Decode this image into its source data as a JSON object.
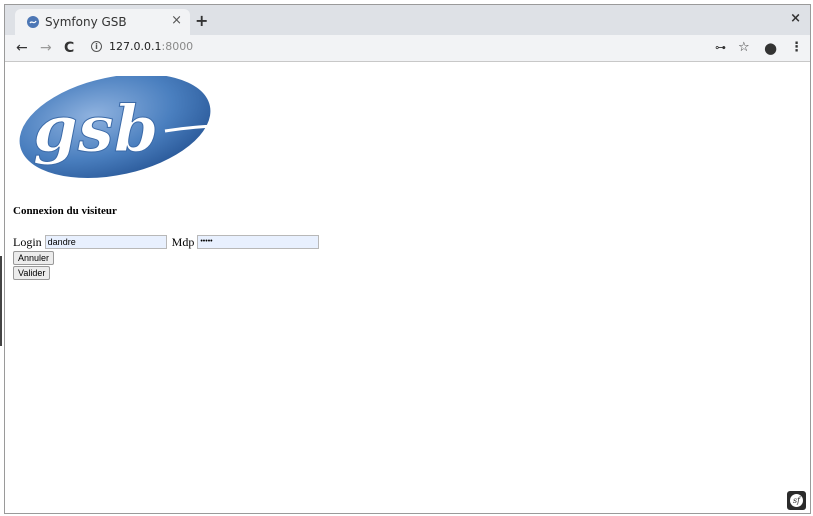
{
  "browser": {
    "tab": {
      "title": "Symfony GSB",
      "close": "×"
    },
    "new_tab": "+",
    "window_close": "×",
    "nav": {
      "back": "←",
      "forward": "→",
      "reload": "C"
    },
    "address": {
      "host": "127.0.0.1",
      "port": ":8000"
    },
    "icons": [
      "key-icon",
      "star-icon",
      "account-icon",
      "menu-icon"
    ],
    "icon_glyphs": {
      "key": "⊶",
      "star": "☆",
      "account": "●",
      "menu": "⋮",
      "info": "i"
    }
  },
  "page": {
    "logo_text": "gsb",
    "heading": "Connexion du visiteur",
    "form": {
      "login_label": "Login",
      "login_value": "dandre",
      "password_label": "Mdp",
      "password_value": "•••••",
      "cancel_label": "Annuler",
      "submit_label": "Valider"
    },
    "debug_badge": "sf"
  },
  "colors": {
    "logo_blue": "#4a7fbf",
    "autofill_bg": "#e8f0fe",
    "tabstrip_bg": "#dee1e6",
    "toolbar_bg": "#f2f3f5"
  }
}
